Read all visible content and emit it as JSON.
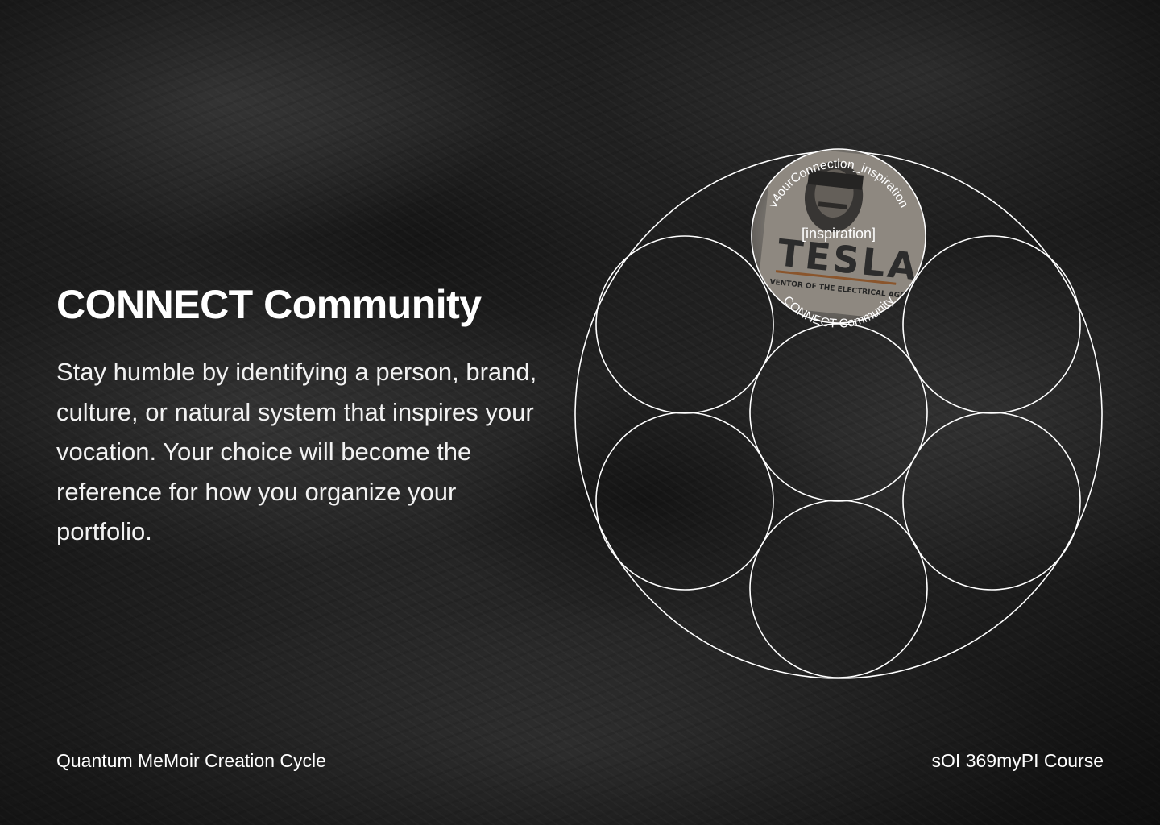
{
  "slide": {
    "heading": "CONNECT Community",
    "body": "Stay humble by identifying a person, brand, culture, or natural system that inspires your vocation. Your choice will become the reference for how you organize your portfolio."
  },
  "footer": {
    "left": "Quantum MeMoir Creation Cycle",
    "right": "sOI 369myPI Course"
  },
  "diagram": {
    "top_circle": {
      "arc_top_label": "v4ourConnection_inspiration",
      "center_label": "[inspiration]",
      "arc_bottom_label": "CONNECT Community",
      "image": {
        "title": "TESLA",
        "subtitle": "VENTOR OF THE ELECTRICAL AGE"
      }
    }
  },
  "colors": {
    "text": "#ffffff",
    "stroke": "#ffffff",
    "background": "#1e1e1e"
  }
}
